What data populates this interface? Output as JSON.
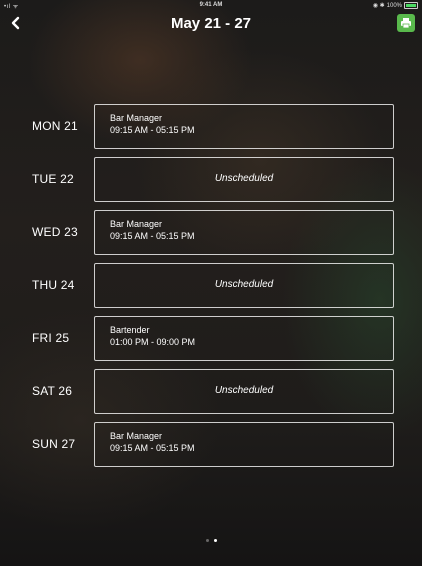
{
  "status_bar": {
    "time": "9:41 AM",
    "battery_text": "100%"
  },
  "header": {
    "title": "May 21 - 27"
  },
  "colors": {
    "print_button": "#59b94c"
  },
  "icons": {
    "back": "chevron-left-icon",
    "print": "printer-icon"
  },
  "schedule": [
    {
      "day": "MON 21",
      "role": "Bar Manager",
      "time": "09:15 AM - 05:15 PM",
      "status": ""
    },
    {
      "day": "TUE 22",
      "role": "",
      "time": "",
      "status": "Unscheduled"
    },
    {
      "day": "WED 23",
      "role": "Bar Manager",
      "time": "09:15 AM - 05:15 PM",
      "status": ""
    },
    {
      "day": "THU 24",
      "role": "",
      "time": "",
      "status": "Unscheduled"
    },
    {
      "day": "FRI 25",
      "role": "Bartender",
      "time": "01:00 PM - 09:00 PM",
      "status": ""
    },
    {
      "day": "SAT 26",
      "role": "",
      "time": "",
      "status": "Unscheduled"
    },
    {
      "day": "SUN 27",
      "role": "Bar Manager",
      "time": "09:15 AM - 05:15 PM",
      "status": ""
    }
  ],
  "pagination": {
    "pages": 2,
    "current": 2
  }
}
